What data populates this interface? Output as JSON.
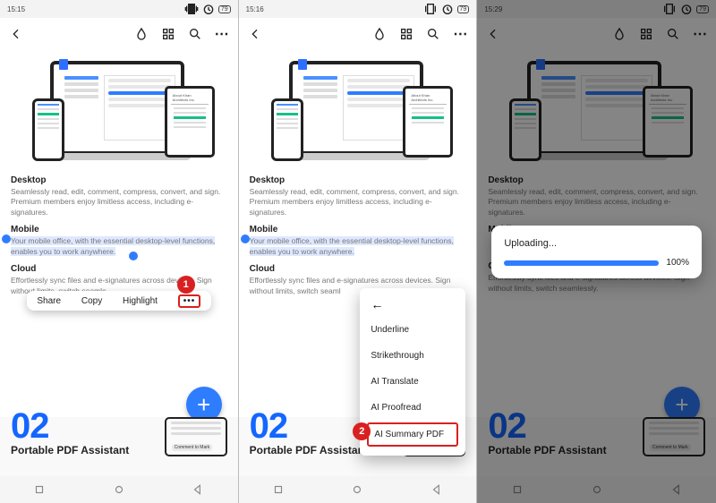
{
  "panel1": {
    "time": "15:15"
  },
  "panel2": {
    "time": "15:16"
  },
  "panel3": {
    "time": "15:29"
  },
  "status_battery": "79",
  "doc": {
    "desktop": {
      "title": "Desktop",
      "body": "Seamlessly read, edit, comment, compress, convert, and sign. Premium members enjoy limitless access, including e-signatures."
    },
    "mobile": {
      "title": "Mobile",
      "body": "Your mobile office, with the essential desktop-level functions, enables you to work anywhere."
    },
    "cloud": {
      "title": "Cloud",
      "body_full": "Effortlessly sync files and e-signatures across devices. Sign without limits, switch seamlessly.",
      "body_trunc1": "Effortlessly sync files and e-signatures across devices. Sign without limits, switch seamle",
      "body_trunc2": "Effortlessly sync files and e-signatures across devices. Sign without limits, switch seaml"
    }
  },
  "popup_sel": {
    "share": "Share",
    "copy": "Copy",
    "highlight": "Highlight",
    "more": "•••"
  },
  "dropdown": {
    "underline": "Underline",
    "strike": "Strikethrough",
    "ai_translate": "AI Translate",
    "ai_proofread": "AI Proofread",
    "ai_summary": "AI Summary PDF"
  },
  "badge": {
    "one": "1",
    "two": "2"
  },
  "next_page": {
    "num": "02",
    "title": "Portable PDF Assistant",
    "thumb_label": "Comment to Mark"
  },
  "upload": {
    "title": "Uploading...",
    "pct_label": "100%",
    "pct_value": 100
  }
}
